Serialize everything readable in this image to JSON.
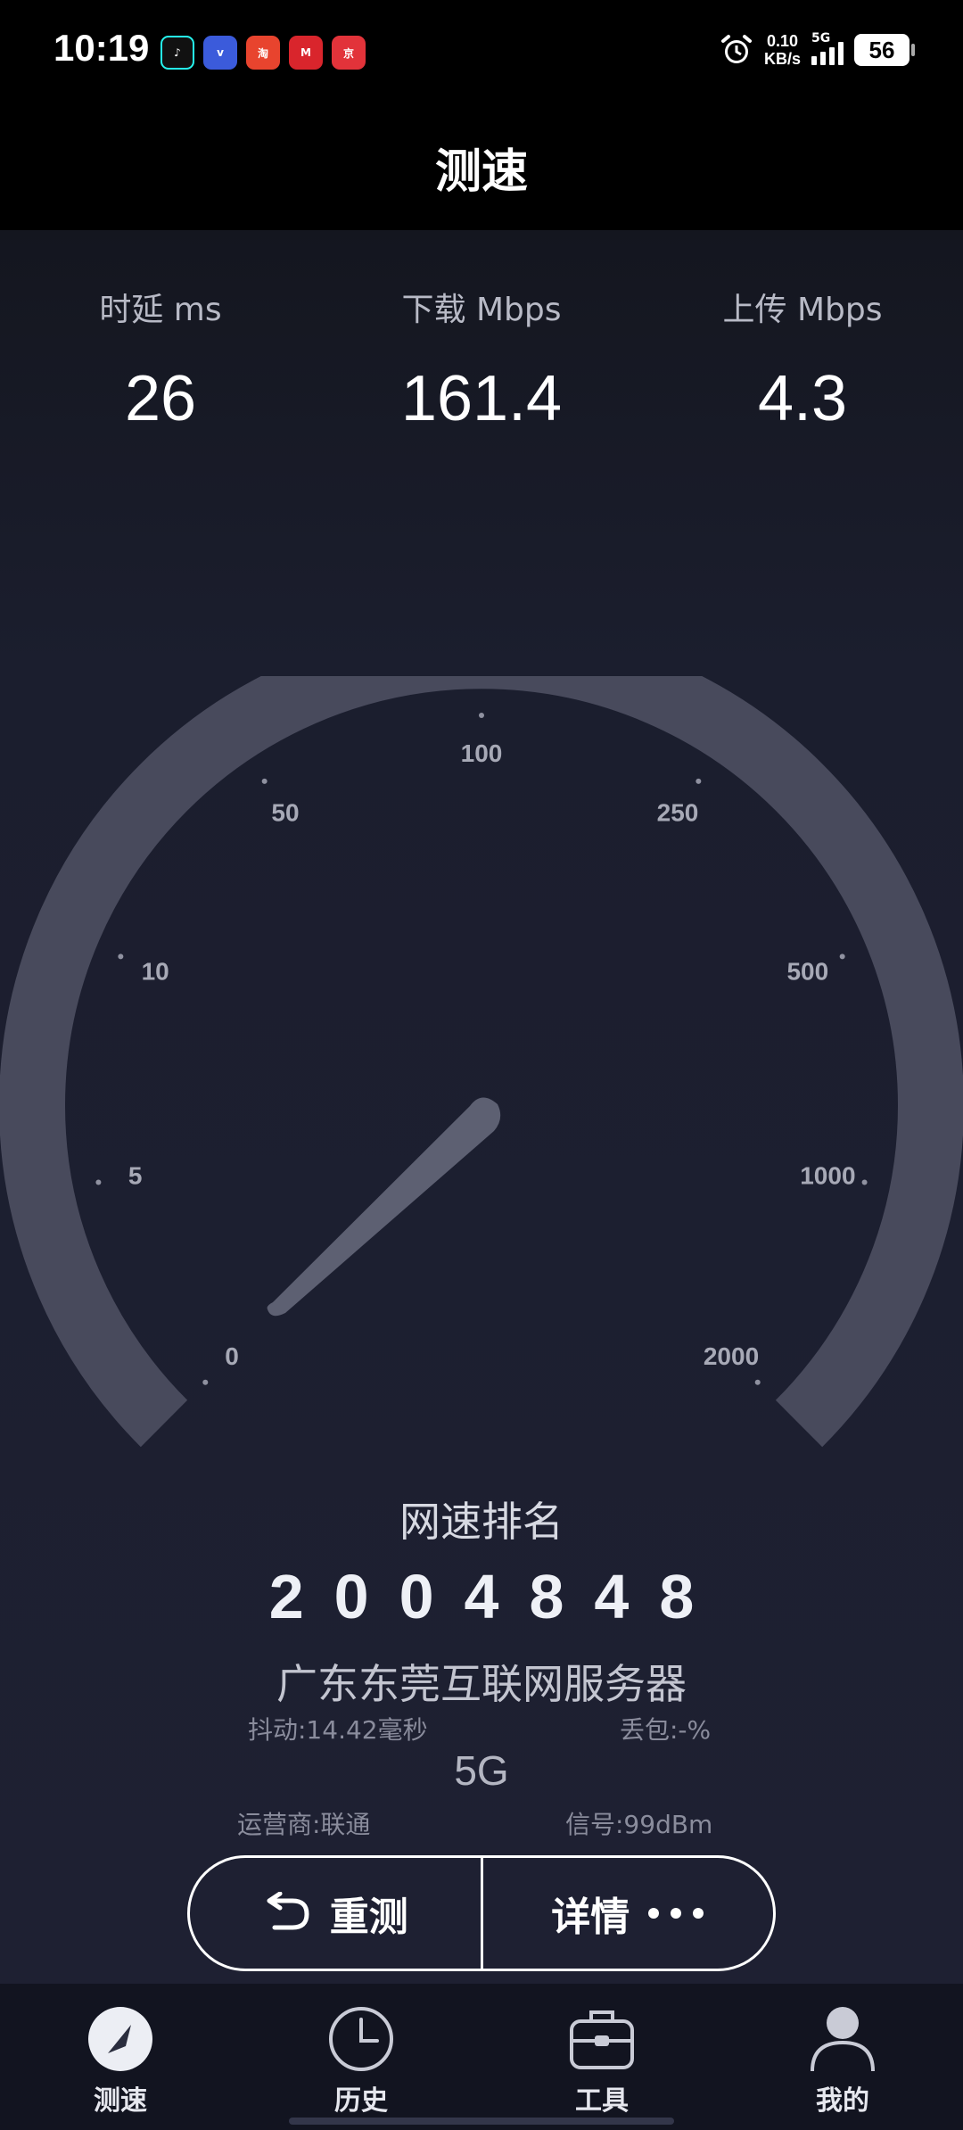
{
  "status_bar": {
    "time": "10:19",
    "network_speed_value": "0.10",
    "network_speed_unit": "KB/s",
    "network_type": "5G",
    "battery": "56",
    "app_icons": [
      "douyin-icon",
      "vivo-icon",
      "taobao-618-icon",
      "meituan-icon",
      "jd-618-icon"
    ]
  },
  "header": {
    "title": "测速"
  },
  "metrics": {
    "latency": {
      "label": "时延 ms",
      "value": "26"
    },
    "download": {
      "label": "下载 Mbps",
      "value": "161.4"
    },
    "upload": {
      "label": "上传 Mbps",
      "value": "4.3"
    }
  },
  "gauge": {
    "tick_labels": [
      "0",
      "5",
      "10",
      "50",
      "100",
      "250",
      "500",
      "1000",
      "2000"
    ],
    "needle_value_mbps": 0
  },
  "rank": {
    "label": "网速排名",
    "value": "2004848"
  },
  "server": {
    "name": "广东东莞互联网服务器",
    "jitter": "抖动:14.42毫秒",
    "packet_loss": "丢包:-%",
    "network_type": "5G",
    "carrier": "运营商:联通",
    "signal": "信号:99dBm"
  },
  "actions": {
    "retest_label": "重测",
    "details_label": "详情",
    "details_icon": "ellipsis-icon",
    "retest_icon": "undo-arrow-icon"
  },
  "bottom_nav": {
    "items": [
      {
        "label": "测速",
        "icon": "speedometer-icon",
        "active": true
      },
      {
        "label": "历史",
        "icon": "clock-icon",
        "active": false
      },
      {
        "label": "工具",
        "icon": "toolbox-icon",
        "active": false
      },
      {
        "label": "我的",
        "icon": "user-icon",
        "active": false
      }
    ]
  },
  "colors": {
    "background_top": "#14161f",
    "background_bottom": "#1e2032",
    "gauge_track": "#484a5c",
    "needle": "#5d6072",
    "tick_label": "#a7a9b6"
  }
}
